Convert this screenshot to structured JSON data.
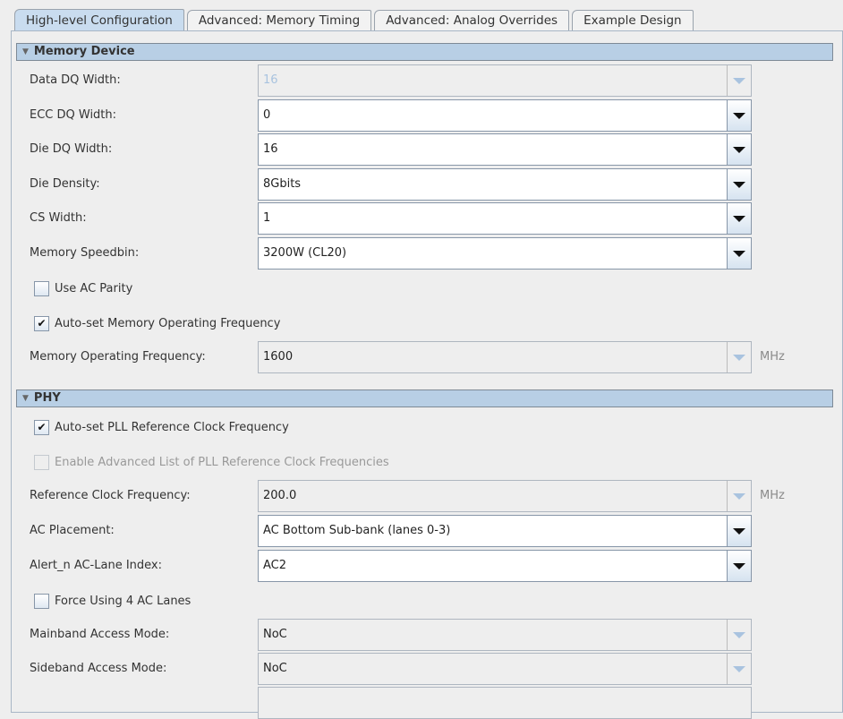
{
  "tabs": [
    "High-level Configuration",
    "Advanced: Memory Timing",
    "Advanced: Analog Overrides",
    "Example Design"
  ],
  "memory_device": {
    "title": "Memory Device",
    "data_dq_width": {
      "label": "Data DQ Width:",
      "value": "16"
    },
    "ecc_dq_width": {
      "label": "ECC DQ Width:",
      "value": "0"
    },
    "die_dq_width": {
      "label": "Die DQ Width:",
      "value": "16"
    },
    "die_density": {
      "label": "Die Density:",
      "value": "8Gbits"
    },
    "cs_width": {
      "label": "CS Width:",
      "value": "1"
    },
    "speedbin": {
      "label": "Memory Speedbin:",
      "value": "3200W (CL20)"
    },
    "use_ac_parity": {
      "label": "Use AC Parity",
      "checked": false
    },
    "auto_freq": {
      "label": "Auto-set Memory Operating Frequency",
      "checked": true,
      "mark": "✔"
    },
    "op_freq": {
      "label": "Memory Operating Frequency:",
      "value": "1600",
      "unit": "MHz"
    }
  },
  "phy": {
    "title": "PHY",
    "auto_pll": {
      "label": "Auto-set PLL Reference Clock Frequency",
      "checked": true,
      "mark": "✔"
    },
    "adv_pll": {
      "label": "Enable Advanced List of PLL Reference Clock Frequencies",
      "checked": false
    },
    "ref_clk": {
      "label": "Reference Clock Frequency:",
      "value": "200.0",
      "unit": "MHz"
    },
    "ac_placement": {
      "label": "AC Placement:",
      "value": "AC Bottom Sub-bank (lanes 0-3)"
    },
    "alert_n": {
      "label": "Alert_n AC-Lane Index:",
      "value": "AC2"
    },
    "force_4ac": {
      "label": "Force Using 4 AC Lanes",
      "checked": false
    },
    "mainband": {
      "label": "Mainband Access Mode:",
      "value": "NoC"
    },
    "sideband": {
      "label": "Sideband Access Mode:",
      "value": "NoC"
    }
  }
}
